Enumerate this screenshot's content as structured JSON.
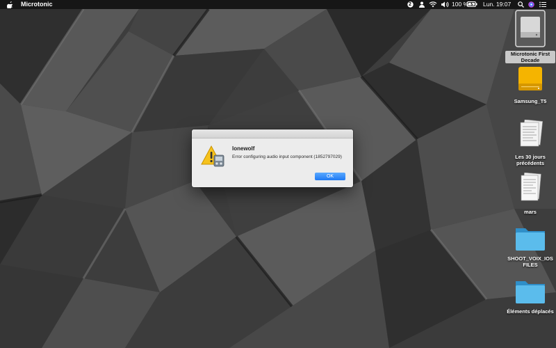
{
  "menubar": {
    "apple_icon": "apple-icon",
    "app_name": "Microtonic",
    "notification_count": "2",
    "battery_percent": "100 %",
    "clock": "Lun. 19:07"
  },
  "desktop_icons": [
    {
      "label": "Microtonic First Decade",
      "icon": "disk-image-icon",
      "selected": true
    },
    {
      "label": "Samsung_T5",
      "icon": "external-drive-icon"
    },
    {
      "label": "Les 30 jours précédents",
      "icon": "document-stack-icon"
    },
    {
      "label": "mars",
      "icon": "document-stack-icon"
    },
    {
      "label": "SHOOT_VOIX_IOS FILES",
      "icon": "folder-icon"
    },
    {
      "label": "Éléments déplacés",
      "icon": "folder-icon"
    }
  ],
  "dialog": {
    "title": "lonewolf",
    "message": "Error configuring audio input component (1852797029)",
    "ok_label": "OK",
    "icon": "warning-icon"
  },
  "colors": {
    "menubar_bg": "#161616",
    "dialog_bg": "#ececec",
    "ok_button": "#1f7af3",
    "folder": "#3fa9e0",
    "drive": "#f5b400"
  }
}
